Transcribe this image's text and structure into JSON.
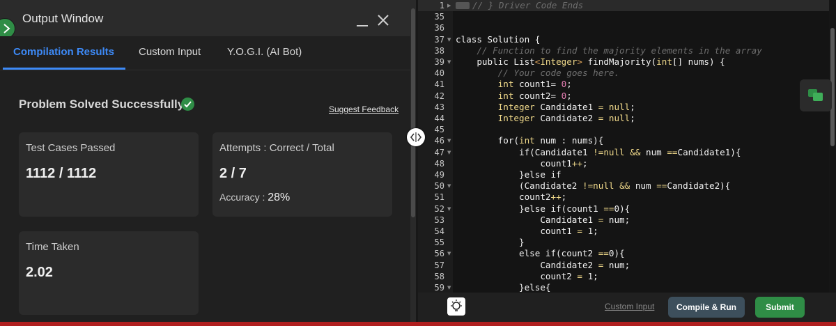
{
  "output_window": {
    "title": "Output Window",
    "tabs": [
      "Compilation Results",
      "Custom Input",
      "Y.O.G.I. (AI Bot)"
    ],
    "active_tab": "Compilation Results",
    "status_text": "Problem Solved Successfully",
    "suggest_feedback": "Suggest Feedback",
    "test_cases": {
      "label": "Test Cases Passed",
      "value": "1112 / 1112"
    },
    "attempts": {
      "label": "Attempts : Correct / Total",
      "value": "2 / 7",
      "accuracy_label": "Accuracy :",
      "accuracy_value": "28%"
    },
    "time_taken": {
      "label": "Time Taken",
      "value": "2.02"
    }
  },
  "editor": {
    "lines": [
      {
        "n": "1",
        "text": "// } Driver Code Ends",
        "fold": "right"
      },
      {
        "n": "35",
        "text": ""
      },
      {
        "n": "36",
        "text": ""
      },
      {
        "n": "37",
        "text": "class Solution {",
        "fold": "down"
      },
      {
        "n": "38",
        "text": "    // Function to find the majority elements in the array"
      },
      {
        "n": "39",
        "text": "    public List<Integer> findMajority(int[] nums) {",
        "fold": "down"
      },
      {
        "n": "40",
        "text": "        // Your code goes here."
      },
      {
        "n": "41",
        "text": "        int count1= 0;"
      },
      {
        "n": "42",
        "text": "        int count2= 0;"
      },
      {
        "n": "43",
        "text": "        Integer Candidate1 = null;"
      },
      {
        "n": "44",
        "text": "        Integer Candidate2 = null;"
      },
      {
        "n": "45",
        "text": ""
      },
      {
        "n": "46",
        "text": "        for(int num : nums){",
        "fold": "down"
      },
      {
        "n": "47",
        "text": "            if(Candidate1 !=null && num ==Candidate1){",
        "fold": "down"
      },
      {
        "n": "48",
        "text": "                count1++;"
      },
      {
        "n": "49",
        "text": "            }else if"
      },
      {
        "n": "50",
        "text": "            (Candidate2 !=null && num ==Candidate2){",
        "fold": "down"
      },
      {
        "n": "51",
        "text": "            count2++;"
      },
      {
        "n": "52",
        "text": "            }else if(count1 ==0){",
        "fold": "down"
      },
      {
        "n": "53",
        "text": "                Candidate1 = num;"
      },
      {
        "n": "54",
        "text": "                count1 = 1;"
      },
      {
        "n": "55",
        "text": "            }"
      },
      {
        "n": "56",
        "text": "            else if(count2 ==0){",
        "fold": "down"
      },
      {
        "n": "57",
        "text": "                Candidate2 = num;"
      },
      {
        "n": "58",
        "text": "                count2 = 1;"
      },
      {
        "n": "59",
        "text": "            }else{",
        "fold": "down"
      }
    ]
  },
  "bottom_bar": {
    "custom_input": "Custom Input",
    "compile_run": "Compile & Run",
    "submit": "Submit"
  },
  "colors": {
    "accent_blue": "#3d8af7",
    "success_green": "#2f8d46",
    "run_button": "#3d4f5c",
    "red_strip": "#b01f1f"
  },
  "icons": [
    "expand-icon",
    "minimize-icon",
    "close-icon",
    "check-circle-icon",
    "splitter-icon",
    "chat-icon",
    "lightbulb-icon",
    "fold-marker-icon"
  ]
}
